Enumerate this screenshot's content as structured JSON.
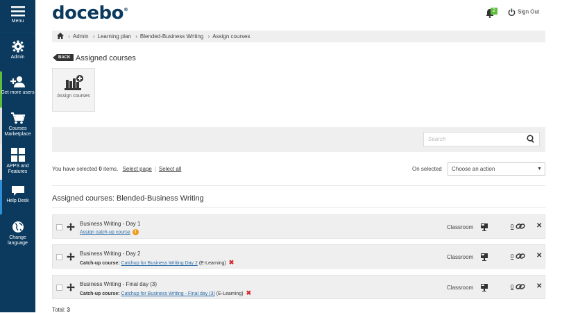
{
  "sidebar": {
    "items": [
      {
        "label": "Menu",
        "icon": "hamburger-icon"
      },
      {
        "label": "Admin",
        "icon": "gear-icon"
      },
      {
        "label": "Get more users",
        "icon": "add-users-icon",
        "accent": "#5ebd3e"
      },
      {
        "label": "Courses Marketplace",
        "icon": "cart-icon",
        "accent": "#e0e0e0"
      },
      {
        "label": "APPS and Features",
        "icon": "apps-grid-icon",
        "accent": "#e8e8e8"
      },
      {
        "label": "Help Desk",
        "icon": "chat-icon",
        "accent": "#2e8fd9"
      },
      {
        "label": "Change language",
        "icon": "globe-icon"
      }
    ]
  },
  "header": {
    "logo": "docebo",
    "logo_mark": "®",
    "notifications_count": "2",
    "signout_label": "Sign Out"
  },
  "breadcrumb": [
    "Admin",
    "Learning plan",
    "Blended-Business Writing",
    "Assign courses"
  ],
  "page": {
    "back_label": "BACK",
    "title": "Assigned courses",
    "assign_tile_label": "Assign courses"
  },
  "filter": {
    "search_placeholder": "Search"
  },
  "selection": {
    "prefix": "You have selected",
    "count": "0",
    "suffix": "items.",
    "select_page": "Select page",
    "select_all": "Select all",
    "on_selected_label": "On selected",
    "action_placeholder": "Choose an action"
  },
  "section_title": "Assigned courses:  Blended-Business Writing",
  "courses": [
    {
      "name": "Business Writing - Day 1",
      "catchup_action": "Assign catch-up course",
      "type": "Classroom",
      "count": "0"
    },
    {
      "name": "Business Writing - Day 2",
      "catchup_label": "Catch-up course:",
      "catchup_link": "Catchup for Business Writing Day 2",
      "catchup_type": "(E-Learning)",
      "type": "Classroom",
      "count": "0"
    },
    {
      "name": "Business Writing - Final day (3)",
      "catchup_label": "Catch-up course:",
      "catchup_link": "Catchup for Business Writing - Final day (3)",
      "catchup_type": "(E-Learning)",
      "type": "Classroom",
      "count": "0"
    }
  ],
  "total_label": "Total:",
  "total_value": "3",
  "colors": {
    "sidebar_bg": "#0b3a5e",
    "brand": "#0b3a5e",
    "link": "#2a6ca8",
    "warning": "#f09a1a",
    "danger": "#d8262b"
  }
}
